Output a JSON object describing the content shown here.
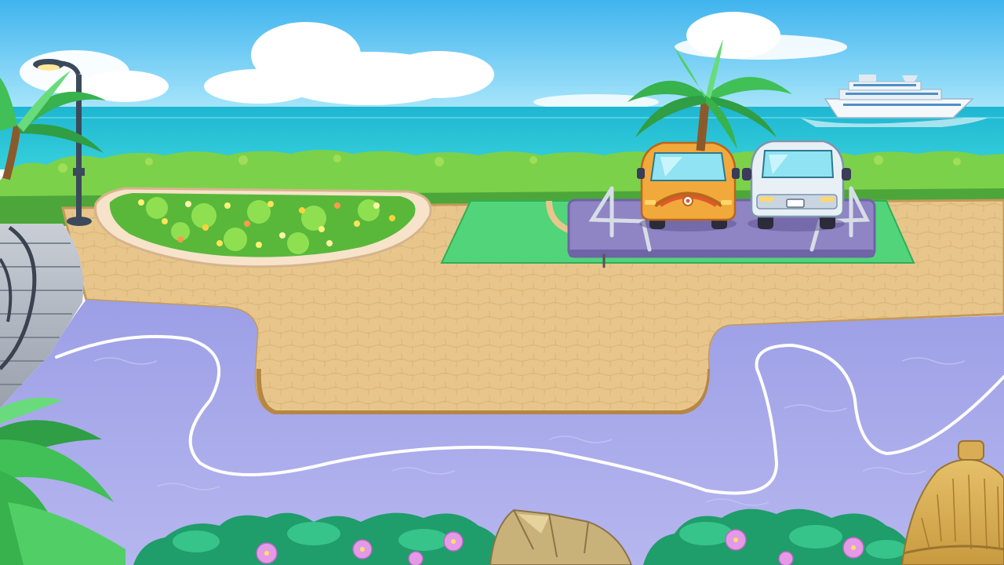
{
  "scene": {
    "type": "seaside parking game level",
    "elements": [
      "sky",
      "sea",
      "cruise-ship",
      "palm-trees",
      "street-lamp",
      "hedge",
      "flower-bed",
      "parking-lot",
      "cars",
      "plaza",
      "pool",
      "bushes",
      "rock",
      "thatched-hut"
    ]
  },
  "parking": {
    "cars": [
      {
        "name": "orange-car",
        "color": "#f2a93b"
      },
      {
        "name": "white-car",
        "color": "#e8f0f6"
      }
    ],
    "lot_color": "#8f84c4",
    "grass_color": "#52d47a"
  },
  "colors": {
    "sky_top": "#3fb4ee",
    "sea": "#27c3d8",
    "hedge": "#6cc43c",
    "plaza": "#e7c488",
    "pool": "#a8a8ea",
    "path_line": "#ffffff"
  }
}
